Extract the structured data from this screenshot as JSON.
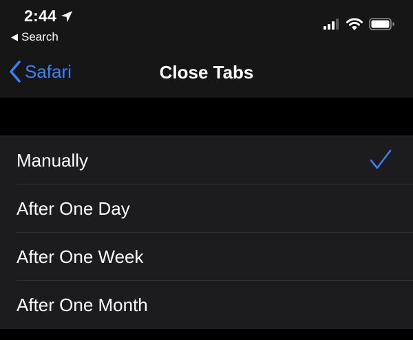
{
  "status_bar": {
    "time": "2:44",
    "back_app_label": "Search"
  },
  "nav": {
    "back_label": "Safari",
    "title": "Close Tabs"
  },
  "options": [
    {
      "label": "Manually",
      "selected": true
    },
    {
      "label": "After One Day",
      "selected": false
    },
    {
      "label": "After One Week",
      "selected": false
    },
    {
      "label": "After One Month",
      "selected": false
    }
  ],
  "icons": {
    "status": [
      "location-arrow-icon",
      "signal-bars-icon",
      "wifi-icon",
      "battery-icon"
    ],
    "nav_back": "chevron-left-icon",
    "selected_marker": "checkmark-icon"
  },
  "colors": {
    "accent": "#3a82f7",
    "header_background": "#161616",
    "list_background": "#1c1c1e",
    "page_background": "#000000",
    "separator": "#333336"
  }
}
